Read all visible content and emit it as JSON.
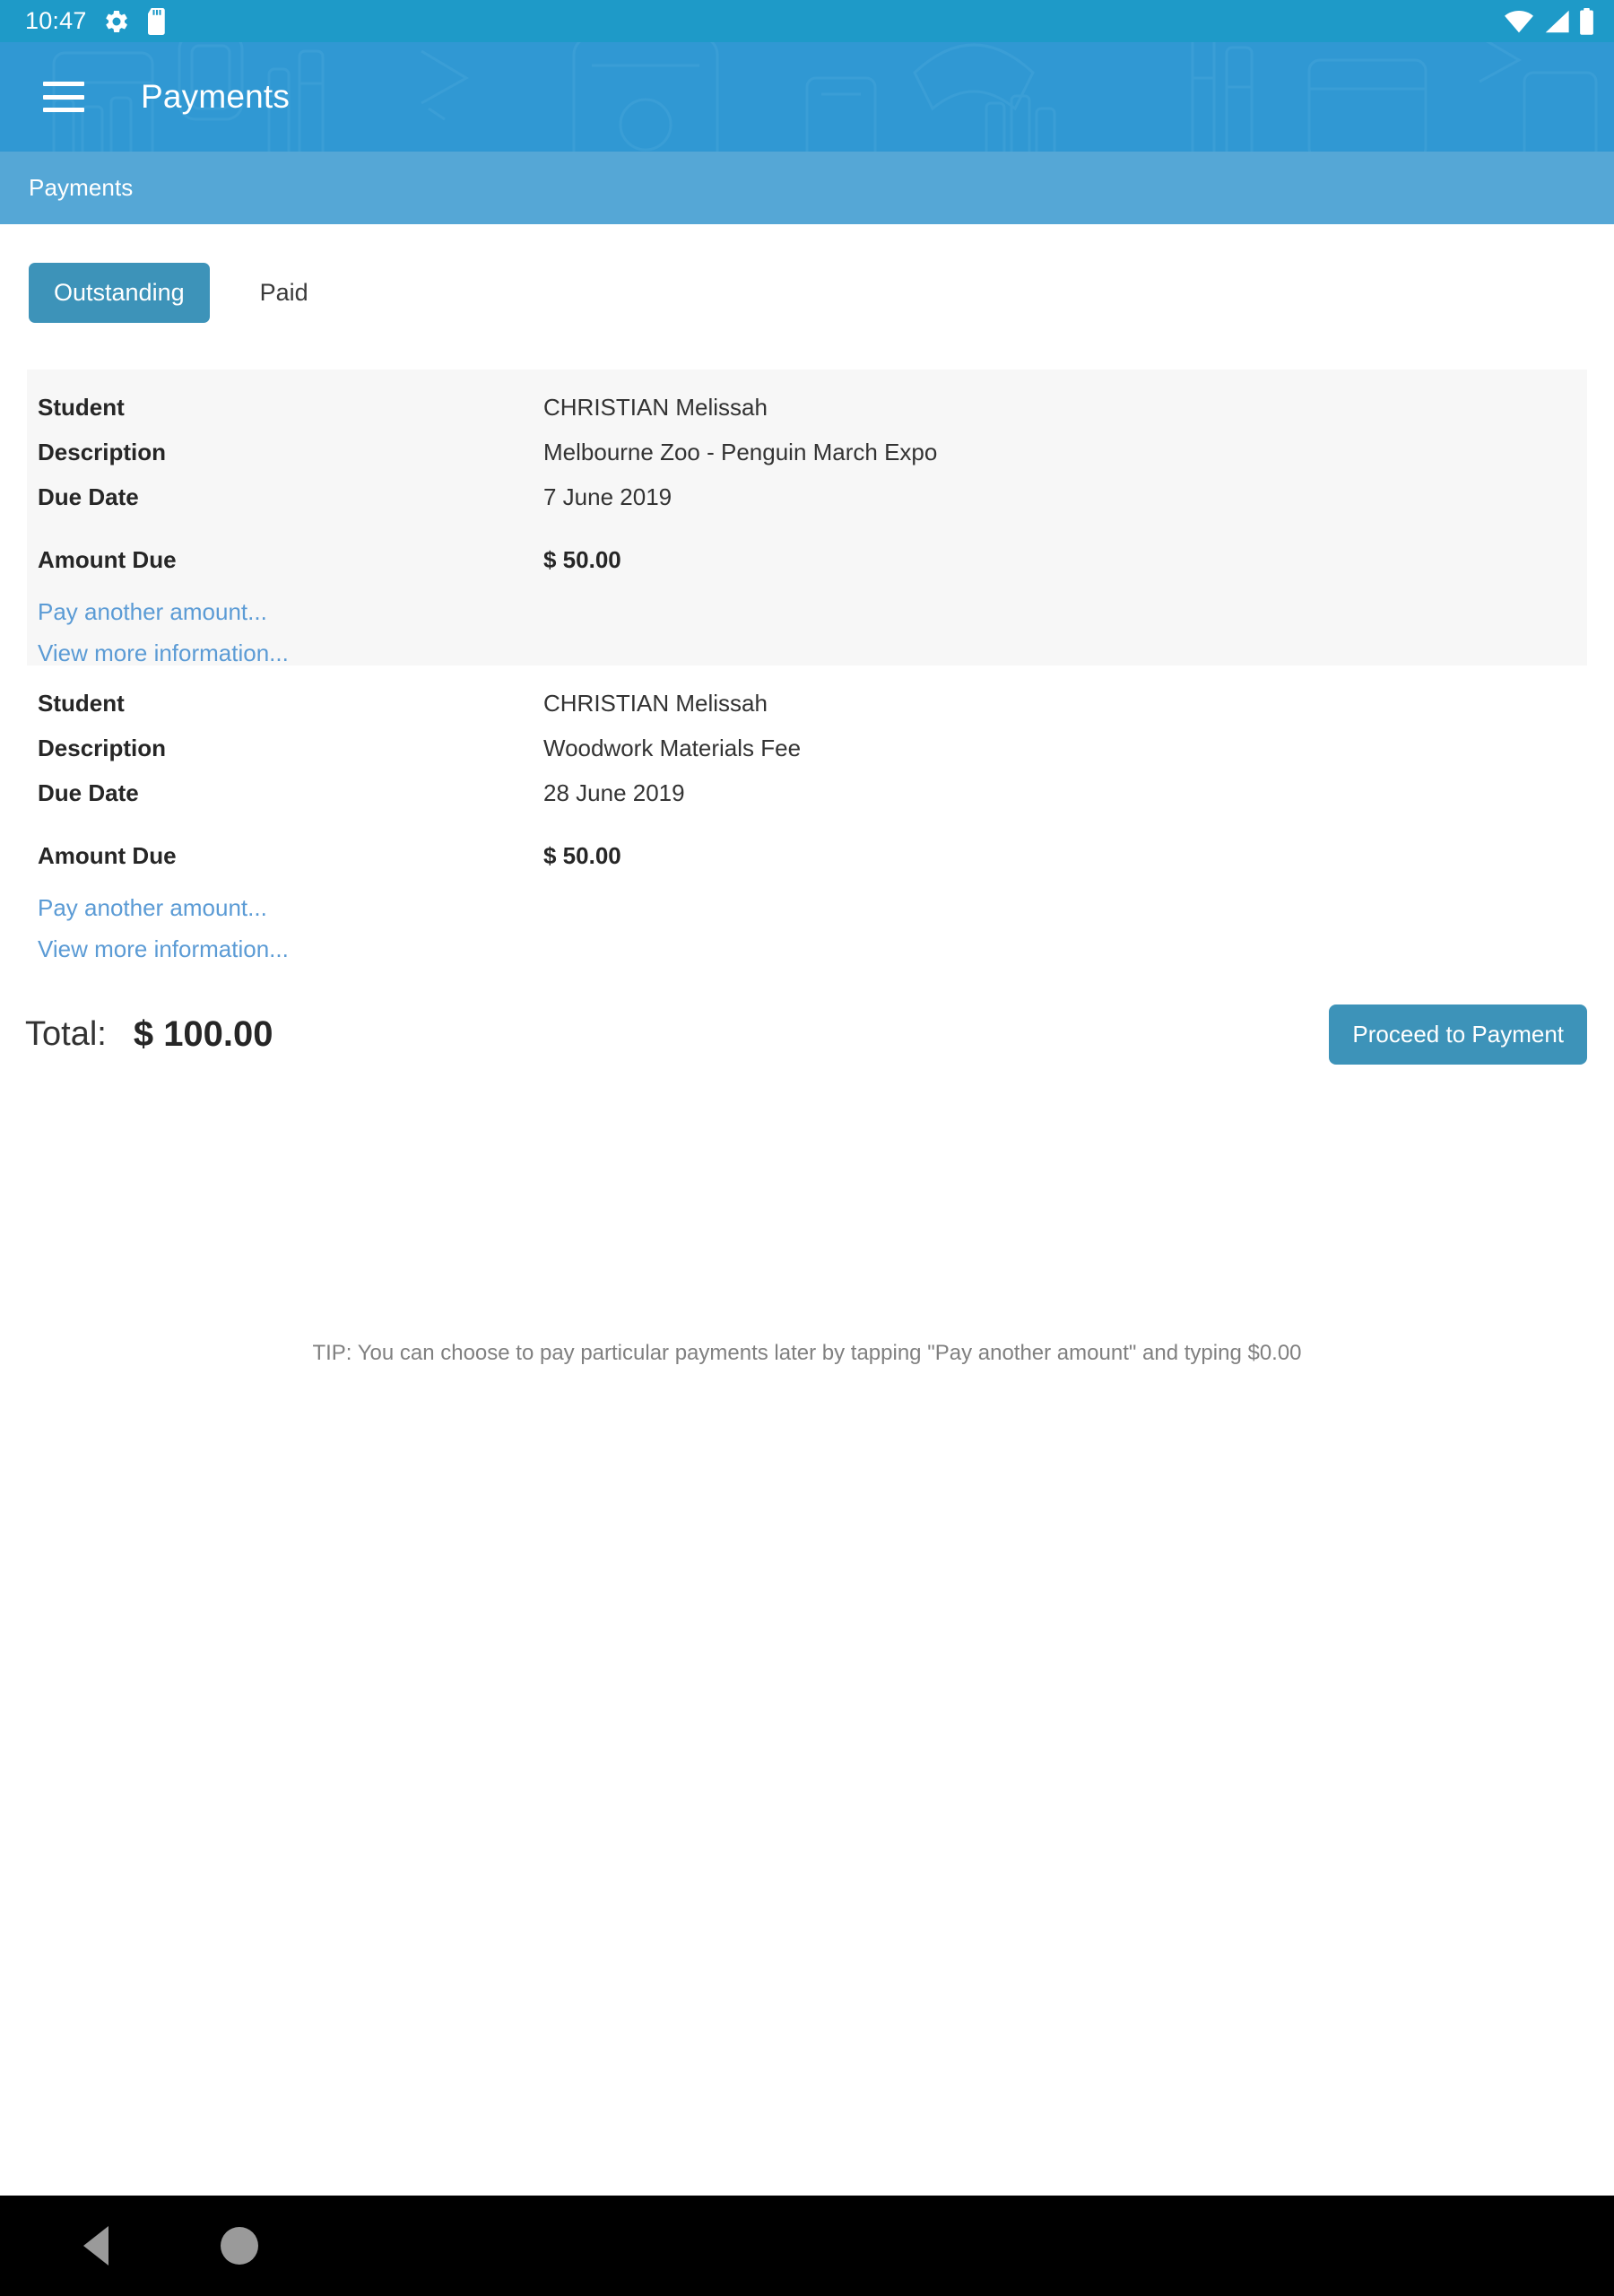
{
  "status_bar": {
    "time": "10:47",
    "icons": [
      "gear-icon",
      "sd-card-icon",
      "wifi-icon",
      "cellular-signal-icon",
      "battery-icon"
    ]
  },
  "app_bar": {
    "menu_icon": "hamburger-menu-icon",
    "title": "Payments"
  },
  "breadcrumb": {
    "text": "Payments"
  },
  "tabs": [
    {
      "label": "Outstanding",
      "active": true
    },
    {
      "label": "Paid",
      "active": false
    }
  ],
  "field_labels": {
    "student": "Student",
    "description": "Description",
    "due_date": "Due Date",
    "amount_due": "Amount Due"
  },
  "actions": {
    "pay_another_amount": "Pay another amount...",
    "view_more_information": "View more information..."
  },
  "payments": [
    {
      "student": "CHRISTIAN Melissah",
      "description": "Melbourne Zoo - Penguin March Expo",
      "due_date": "7 June 2019",
      "amount_due": "$ 50.00"
    },
    {
      "student": "CHRISTIAN Melissah",
      "description": "Woodwork Materials Fee",
      "due_date": "28 June 2019",
      "amount_due": "$ 50.00"
    }
  ],
  "total": {
    "label": "Total:",
    "value": "$ 100.00"
  },
  "proceed_button": {
    "label": "Proceed to Payment"
  },
  "tip": {
    "text": "TIP: You can choose to pay particular payments later by tapping \"Pay another amount\" and typing $0.00"
  },
  "nav_bar": {
    "back": "back-icon",
    "home": "home-icon"
  },
  "colors": {
    "status_bar": "#1E9AC8",
    "app_bar": "#3098D3",
    "breadcrumb": "#55A7D6",
    "accent": "#3D93B9",
    "link": "#5B9BD5",
    "card_shaded": "#F7F7F7"
  }
}
